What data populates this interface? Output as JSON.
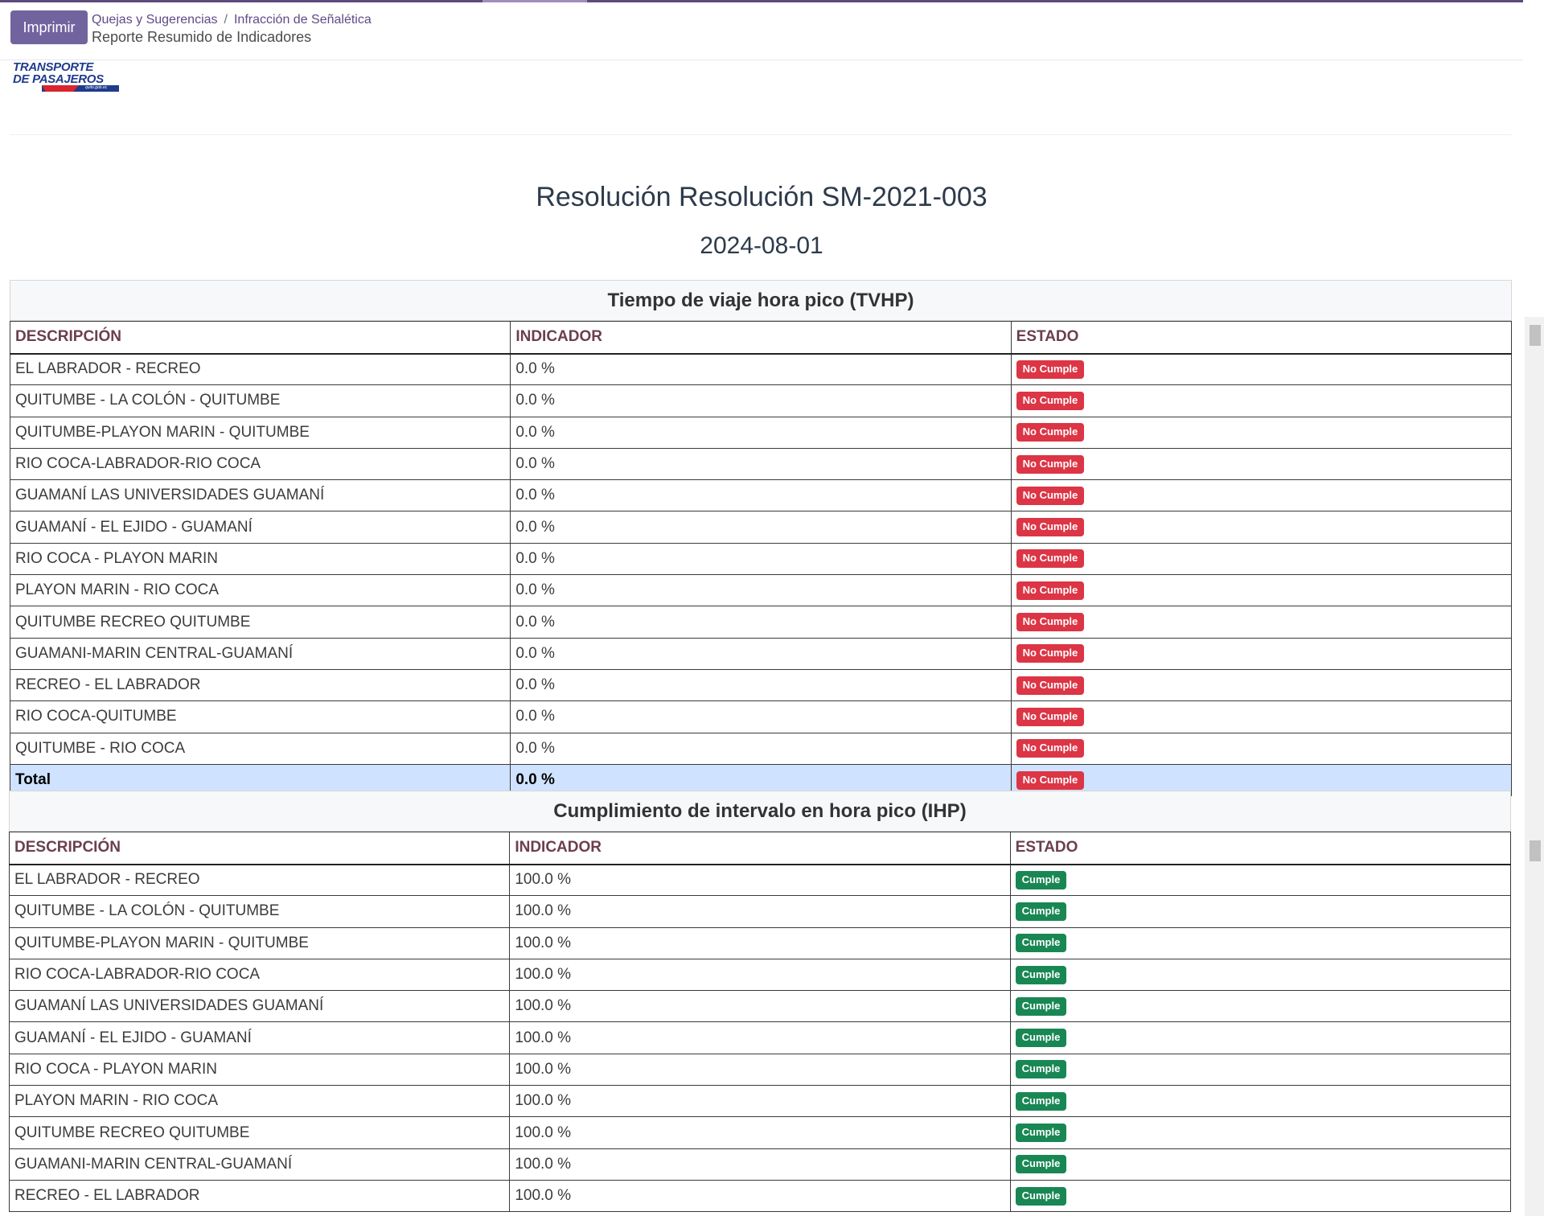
{
  "toolbar": {
    "print_label": "Imprimir",
    "breadcrumb": [
      "Quejas y Sugerencias",
      "Infracción de Señalética"
    ],
    "breadcrumb_sep": "/",
    "subtitle": "Reporte Resumido de Indicadores"
  },
  "logo": {
    "line1": "TRANSPORTE",
    "line2": "DE PASAJEROS",
    "tagline": "quito.gob.ec"
  },
  "report": {
    "title": "Resolución Resolución SM-2021-003",
    "date": "2024-08-01"
  },
  "columns": {
    "description": "DESCRIPCIÓN",
    "indicator": "INDICADOR",
    "status": "ESTADO"
  },
  "sections": [
    {
      "title": "Tiempo de viaje hora pico (TVHP)",
      "rows": [
        {
          "desc": "EL LABRADOR - RECREO",
          "value": "0.0 %",
          "status": "No Cumple"
        },
        {
          "desc": "QUITUMBE - LA COLÓN - QUITUMBE",
          "value": "0.0 %",
          "status": "No Cumple"
        },
        {
          "desc": "QUITUMBE-PLAYON MARIN - QUITUMBE",
          "value": "0.0 %",
          "status": "No Cumple"
        },
        {
          "desc": "RIO COCA-LABRADOR-RIO COCA",
          "value": "0.0 %",
          "status": "No Cumple"
        },
        {
          "desc": "GUAMANÍ LAS UNIVERSIDADES GUAMANÍ",
          "value": "0.0 %",
          "status": "No Cumple"
        },
        {
          "desc": "GUAMANÍ - EL EJIDO - GUAMANÍ",
          "value": "0.0 %",
          "status": "No Cumple"
        },
        {
          "desc": "RIO COCA - PLAYON MARIN",
          "value": "0.0 %",
          "status": "No Cumple"
        },
        {
          "desc": "PLAYON MARIN - RIO COCA",
          "value": "0.0 %",
          "status": "No Cumple"
        },
        {
          "desc": "QUITUMBE RECREO QUITUMBE",
          "value": "0.0 %",
          "status": "No Cumple"
        },
        {
          "desc": "GUAMANI-MARIN CENTRAL-GUAMANÍ",
          "value": "0.0 %",
          "status": "No Cumple"
        },
        {
          "desc": "RECREO - EL LABRADOR",
          "value": "0.0 %",
          "status": "No Cumple"
        },
        {
          "desc": "RIO COCA-QUITUMBE",
          "value": "0.0 %",
          "status": "No Cumple"
        },
        {
          "desc": "QUITUMBE - RIO COCA",
          "value": "0.0 %",
          "status": "No Cumple"
        }
      ],
      "total": {
        "desc": "Total",
        "value": "0.0 %",
        "status": "No Cumple"
      }
    },
    {
      "title": "Cumplimiento de intervalo en hora pico (IHP)",
      "rows": [
        {
          "desc": "EL LABRADOR - RECREO",
          "value": "100.0 %",
          "status": "Cumple"
        },
        {
          "desc": "QUITUMBE - LA COLÓN - QUITUMBE",
          "value": "100.0 %",
          "status": "Cumple"
        },
        {
          "desc": "QUITUMBE-PLAYON MARIN - QUITUMBE",
          "value": "100.0 %",
          "status": "Cumple"
        },
        {
          "desc": "RIO COCA-LABRADOR-RIO COCA",
          "value": "100.0 %",
          "status": "Cumple"
        },
        {
          "desc": "GUAMANÍ LAS UNIVERSIDADES GUAMANÍ",
          "value": "100.0 %",
          "status": "Cumple"
        },
        {
          "desc": "GUAMANÍ - EL EJIDO - GUAMANÍ",
          "value": "100.0 %",
          "status": "Cumple"
        },
        {
          "desc": "RIO COCA - PLAYON MARIN",
          "value": "100.0 %",
          "status": "Cumple"
        },
        {
          "desc": "PLAYON MARIN - RIO COCA",
          "value": "100.0 %",
          "status": "Cumple"
        },
        {
          "desc": "QUITUMBE RECREO QUITUMBE",
          "value": "100.0 %",
          "status": "Cumple"
        },
        {
          "desc": "GUAMANI-MARIN CENTRAL-GUAMANÍ",
          "value": "100.0 %",
          "status": "Cumple"
        },
        {
          "desc": "RECREO - EL LABRADOR",
          "value": "100.0 %",
          "status": "Cumple"
        }
      ]
    }
  ],
  "colors": {
    "accent": "#71639e",
    "fail": "#dc3545",
    "pass": "#198754",
    "total_row": "#cfe2ff"
  }
}
